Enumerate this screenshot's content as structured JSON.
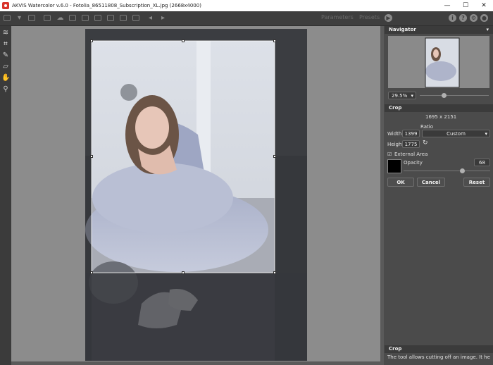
{
  "window": {
    "title": "AKVIS Watercolor v.6.0 - Fotolia_86511808_Subscription_XL.jpg (2668x4000)",
    "minimize": "—",
    "maximize": "☐",
    "close": "✕"
  },
  "toolbar": {
    "parameters_label": "Parameters",
    "presets_label": "Presets",
    "play": "▶",
    "info": "i",
    "help": "?",
    "settings": "⚙",
    "feedback": "●"
  },
  "navigator": {
    "title": "Navigator",
    "menu": "▾",
    "zoom_value": "29.5%",
    "zoom_level": 0.35
  },
  "crop": {
    "title": "Crop",
    "dimensions": "1695 x 2151",
    "ratio_label": "Ratio",
    "width_label": "Width",
    "width_value": "1399",
    "height_label": "Height",
    "height_value": "1775",
    "ratio_value": "Custom",
    "external_area_label": "External Area",
    "external_area_checked": "☑",
    "opacity_label": "Opacity",
    "opacity_value": "68",
    "opacity_level": 0.68,
    "area_color": "#000000",
    "ok_label": "OK",
    "cancel_label": "Cancel",
    "reset_label": "Reset"
  },
  "help": {
    "title": "Crop",
    "text": "The tool allows cutting off an image. It helps to"
  },
  "icons": [
    "undo-icon",
    "crop-icon",
    "pencil-icon",
    "eraser-icon",
    "hand-icon",
    "zoom-icon"
  ],
  "colors": {
    "accent": "#ffffff",
    "panel": "#4b4b4b",
    "canvas": "#8c8c8c"
  }
}
